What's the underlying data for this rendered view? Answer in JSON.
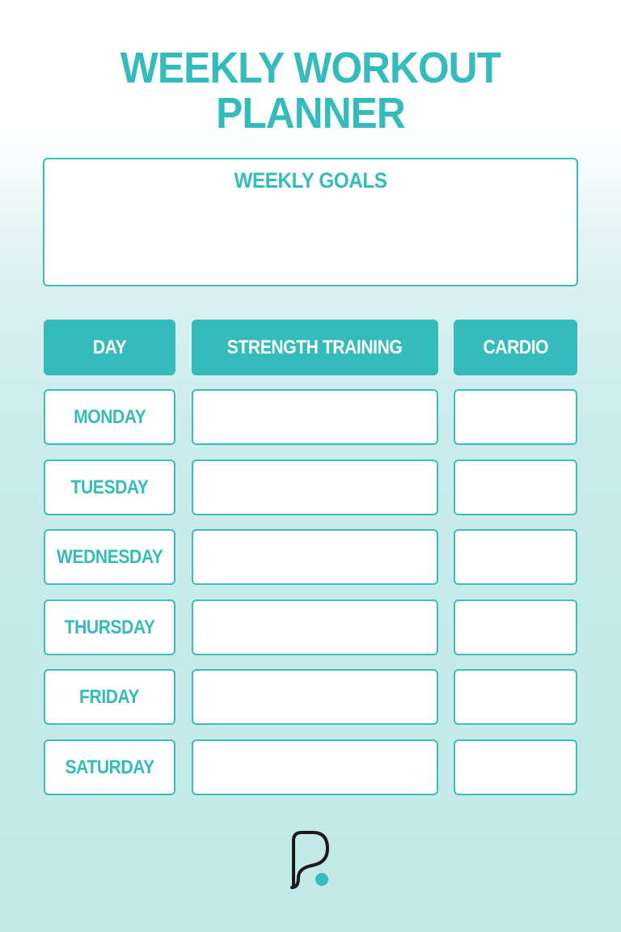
{
  "title": {
    "line1": "WEEKLY WORKOUT",
    "line2": "PLANNER"
  },
  "goals": {
    "title": "WEEKLY GOALS"
  },
  "table": {
    "headers": [
      "DAY",
      "STRENGTH TRAINING",
      "CARDIO"
    ],
    "days": [
      "MONDAY",
      "TUESDAY",
      "WEDNESDAY",
      "THURSDAY",
      "FRIDAY",
      "SATURDAY"
    ]
  },
  "colors": {
    "accent": "#33bcbb",
    "logo_stroke": "#1a1a1a",
    "background_top": "#ffffff",
    "background_bottom": "#c2e8e8"
  },
  "logo": {
    "icon": "brand-p-logo-icon"
  }
}
